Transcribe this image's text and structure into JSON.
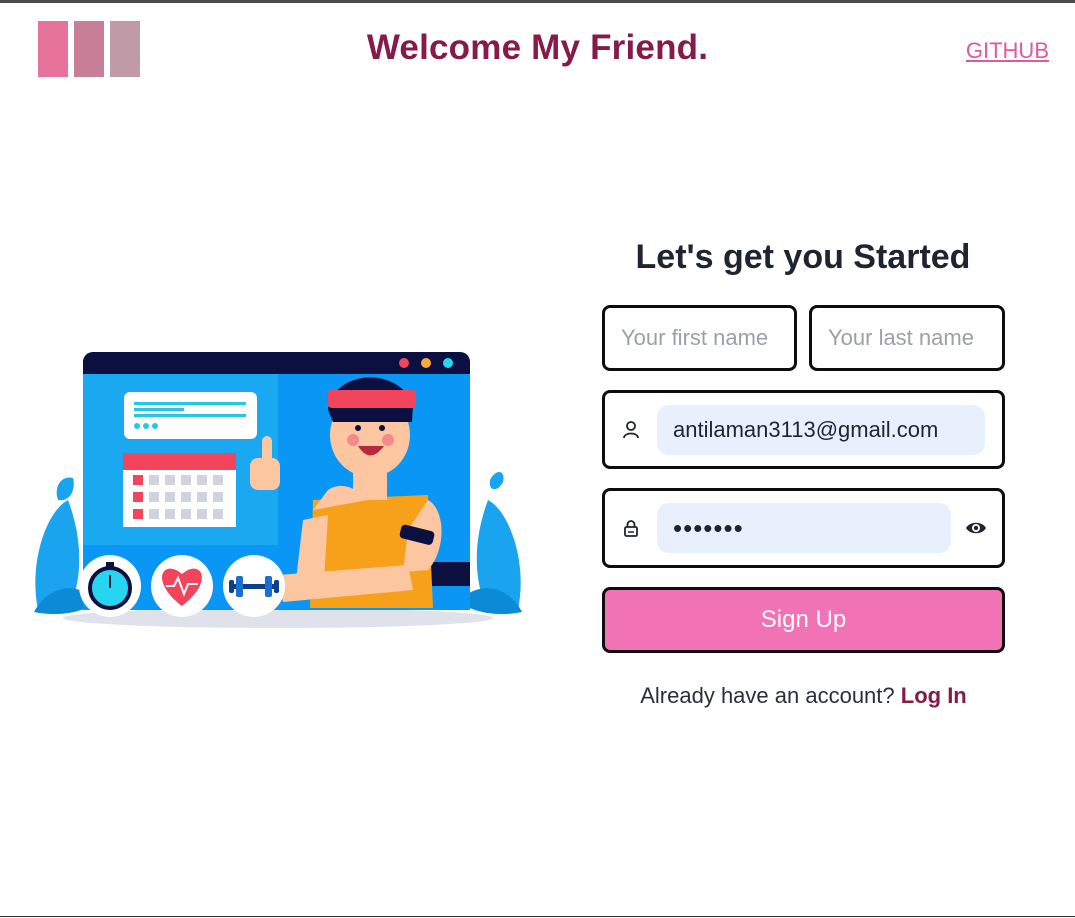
{
  "header": {
    "title": "Welcome My Friend.",
    "github_link": "GITHUB",
    "logo_colors": [
      "#e8739a",
      "#c87e96",
      "#c09aa6"
    ]
  },
  "form": {
    "title": "Let's get you Started",
    "first_name": {
      "placeholder": "Your first name",
      "value": ""
    },
    "last_name": {
      "placeholder": "Your last name",
      "value": ""
    },
    "email": {
      "value": "antilaman3113@gmail.com",
      "icon": "user-icon"
    },
    "password": {
      "masked_value": "•••••••",
      "icon": "lock-icon",
      "toggle_icon": "eye-icon"
    },
    "signup_label": "Sign Up",
    "login_prompt": "Already have an account?",
    "login_link": "Log In"
  },
  "colors": {
    "brand": "#861a48",
    "accent_button": "#f272b6",
    "link_pink": "#e05a9b",
    "input_fill": "#e8f0fd"
  }
}
